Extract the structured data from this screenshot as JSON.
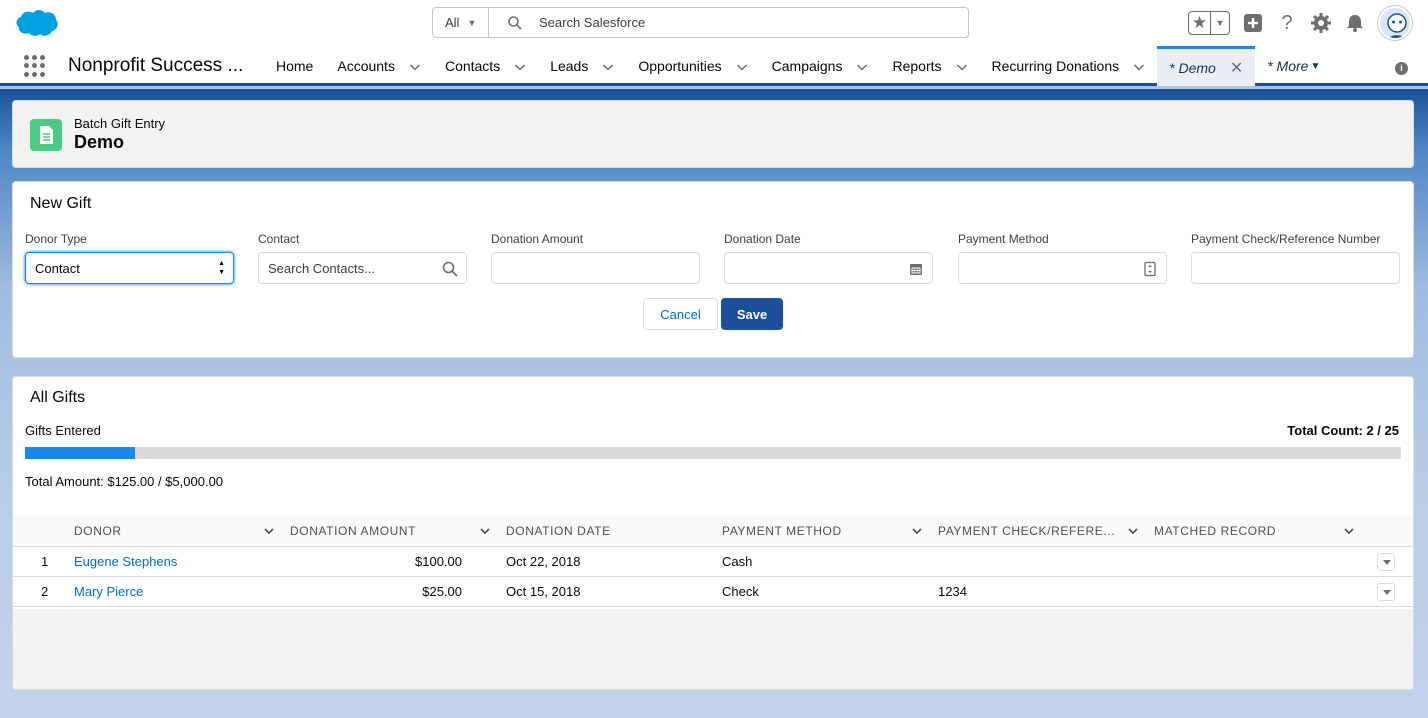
{
  "header": {
    "search_scope": "All",
    "search_placeholder": "Search Salesforce"
  },
  "nav": {
    "app_name": "Nonprofit Success ...",
    "items": [
      {
        "label": "Home",
        "has_menu": false
      },
      {
        "label": "Accounts",
        "has_menu": true
      },
      {
        "label": "Contacts",
        "has_menu": true
      },
      {
        "label": "Leads",
        "has_menu": true
      },
      {
        "label": "Opportunities",
        "has_menu": true
      },
      {
        "label": "Campaigns",
        "has_menu": true
      },
      {
        "label": "Reports",
        "has_menu": true
      },
      {
        "label": "Recurring Donations",
        "has_menu": true
      }
    ],
    "active_tab": "* Demo",
    "more_label": "* More"
  },
  "page_header": {
    "eyebrow": "Batch Gift Entry",
    "title": "Demo"
  },
  "new_gift": {
    "title": "New Gift",
    "fields": {
      "donor_type": {
        "label": "Donor Type",
        "value": "Contact"
      },
      "contact": {
        "label": "Contact",
        "placeholder": "Search Contacts..."
      },
      "donation_amount": {
        "label": "Donation Amount",
        "value": ""
      },
      "donation_date": {
        "label": "Donation Date",
        "value": ""
      },
      "payment_method": {
        "label": "Payment Method",
        "value": ""
      },
      "payment_ref": {
        "label": "Payment Check/Reference Number",
        "value": ""
      }
    },
    "cancel_label": "Cancel",
    "save_label": "Save"
  },
  "all_gifts": {
    "title": "All Gifts",
    "gifts_entered_label": "Gifts Entered",
    "total_count": "Total Count: 2 / 25",
    "progress_fraction": 0.08,
    "total_amount": "Total Amount: $125.00 / $5,000.00",
    "columns": [
      "DONOR",
      "DONATION AMOUNT",
      "DONATION DATE",
      "PAYMENT METHOD",
      "PAYMENT CHECK/REFERE...",
      "MATCHED RECORD"
    ],
    "rows": [
      {
        "num": "1",
        "donor": "Eugene Stephens",
        "amount": "$100.00",
        "date": "Oct 22, 2018",
        "method": "Cash",
        "ref": "",
        "matched": ""
      },
      {
        "num": "2",
        "donor": "Mary Pierce",
        "amount": "$25.00",
        "date": "Oct 15, 2018",
        "method": "Check",
        "ref": "1234",
        "matched": ""
      }
    ]
  },
  "colors": {
    "brand_blue": "#0070d2",
    "nav_accent": "#1b5297",
    "progress": "#1589ee",
    "app_icon": "#4bca81"
  }
}
